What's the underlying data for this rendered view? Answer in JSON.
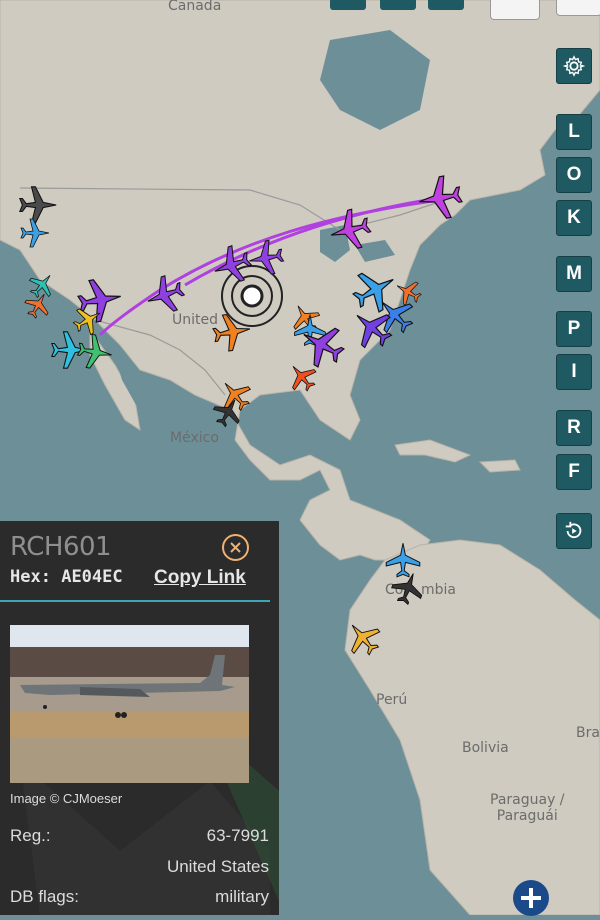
{
  "map": {
    "labels": {
      "canada": "Canada",
      "united_states": "United",
      "mexico": "México",
      "colombia_left": "Co",
      "colombia_right": "mbia",
      "peru": "Perú",
      "bolivia": "Bolivia",
      "brazil": "Bra",
      "paraguay": "Paraguay /\nParaguái"
    }
  },
  "toolbar": {
    "settings_icon": "gear-icon",
    "buttons": [
      "L",
      "O",
      "K",
      "M",
      "P",
      "I",
      "R",
      "F"
    ],
    "replay_icon": "replay-icon"
  },
  "aircraft_detail": {
    "callsign": "RCH601",
    "hex_label": "Hex:",
    "hex_value": "AE04EC",
    "copy_link": "Copy Link",
    "image_credit": "Image © CJMoeser",
    "reg_label": "Reg.:",
    "reg_value": "63-7991",
    "country": "United States",
    "db_flags_label": "DB flags:",
    "db_flags_value": "military"
  },
  "colors": {
    "panel_bg": "#2b2b2b",
    "accent_teal": "#3aa8b4",
    "button_bg": "#1f5a63",
    "track_purple": "#b040e0"
  }
}
